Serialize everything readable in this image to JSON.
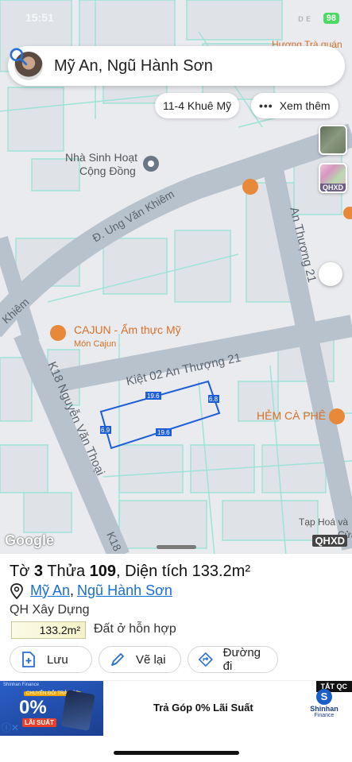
{
  "status": {
    "time": "15:51",
    "right_text": "ᴅ ᴇ",
    "battery": "98"
  },
  "search": {
    "text": "Mỹ An, Ngũ Hành Sơn"
  },
  "chips": {
    "address": "11-4 Khuê Mỹ",
    "more_dots": "•••",
    "more": "Xem thêm"
  },
  "layers": {
    "qhxd": "QHXD"
  },
  "map": {
    "labels": {
      "poi1_line1": "Nhà Sinh Hoạt",
      "poi1_line2": "Cộng Đồng",
      "street1": "Đ. Ung Văn Khiêm",
      "street2": "An Thượng 21",
      "street3": "Kiệt 02 An Thượng 21",
      "street4": "K18 Nguyễn Văn Thoại",
      "street5": "Khiêm",
      "restaurant": "CAJUN - Ẩm thực Mỹ",
      "restaurant_sub": "Món Cajun",
      "cafe": "HẺM CÀ PHÊ",
      "shop": "Tạp Hoá và",
      "shop2": "Cửa",
      "top_right": "Hương Trà quán",
      "edge_k18": "K18",
      "dim_top": "19.6",
      "dim_bottom": "19.6",
      "dim_left": "6.9",
      "dim_right": "6.8"
    },
    "google": "Google",
    "qhxd_mark": "QHXD"
  },
  "parcel": {
    "title_prefix": "Tờ",
    "sheet_no": "3",
    "plot_word": "Thửa",
    "plot_no": "109",
    "area_text": ", Diện tích 133.2m²",
    "ward": "Mỹ An",
    "sep": ",",
    "district": "Ngũ Hành Sơn",
    "qh_label": "QH Xây Dựng",
    "area_badge": "133.2m²",
    "landuse": "Đất ở hỗn hợp"
  },
  "actions": {
    "save": "Lưu",
    "draw": "Vẽ lại",
    "directions": "Đường đi"
  },
  "ad": {
    "brand": "Shinhan Finance",
    "tag_small": "CHUYỂN ĐỔI TRẢ GÓP",
    "pct": "0%",
    "lai": "LÃI SUẤT",
    "text": "Trả Góp 0% Lãi Suất",
    "corner": "TẮT QC",
    "logo_letter": "S",
    "logo_name": "Shinhan",
    "logo_sub": "Finance",
    "close": "ⓘ✕"
  }
}
